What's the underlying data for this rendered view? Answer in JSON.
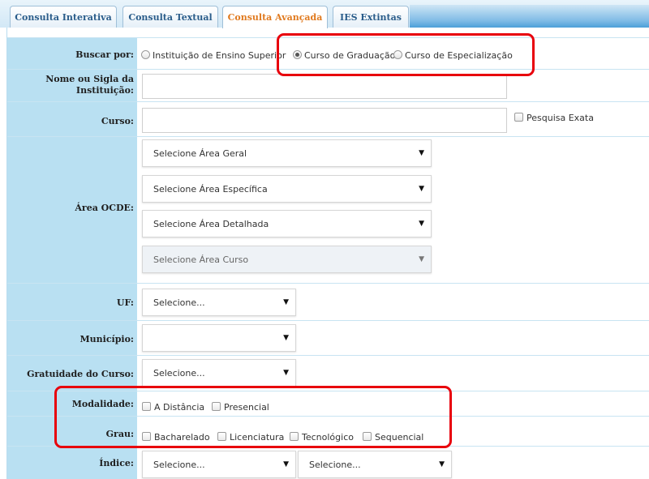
{
  "tabs": [
    {
      "label": "Consulta Interativa"
    },
    {
      "label": "Consulta Textual"
    },
    {
      "label": "Consulta Avançada"
    },
    {
      "label": "IES Extintas"
    }
  ],
  "form": {
    "buscar_por": {
      "label": "Buscar por:",
      "options": [
        "Instituição de Ensino Superior",
        "Curso de Graduação",
        "Curso de Especialização"
      ],
      "selected": "Curso de Graduação"
    },
    "nome": {
      "label_line1": "Nome ou Sigla da",
      "label_line2": "Instituição:",
      "value": ""
    },
    "curso": {
      "label": "Curso:",
      "value": "",
      "exact_label": "Pesquisa Exata"
    },
    "area_ocde": {
      "label": "Área OCDE:",
      "selects": [
        "Selecione Área Geral",
        "Selecione Área Específica",
        "Selecione Área Detalhada",
        "Selecione Área Curso"
      ]
    },
    "uf": {
      "label": "UF:",
      "value": "Selecione..."
    },
    "municipio": {
      "label": "Município:",
      "value": ""
    },
    "gratuidade": {
      "label": "Gratuidade do Curso:",
      "value": "Selecione..."
    },
    "modalidade": {
      "label": "Modalidade:",
      "options": [
        "A Distância",
        "Presencial"
      ]
    },
    "grau": {
      "label": "Grau:",
      "options": [
        "Bacharelado",
        "Licenciatura",
        "Tecnológico",
        "Sequencial"
      ]
    },
    "indice": {
      "label": "Índice:",
      "value1": "Selecione...",
      "value2": "Selecione..."
    }
  },
  "icons": {
    "caret": "▼"
  },
  "colors": {
    "label_bg": "#b9e0f2",
    "active_tab": "#e07a1f",
    "highlight": "#e8000c"
  }
}
